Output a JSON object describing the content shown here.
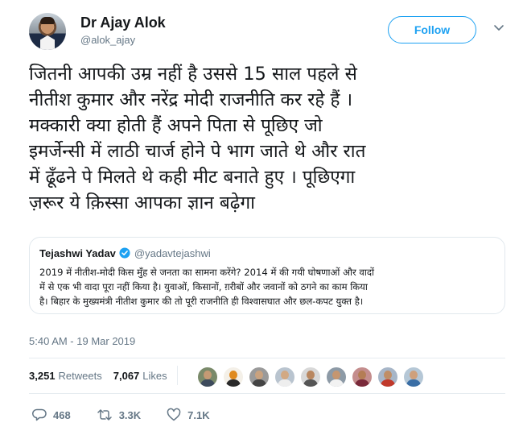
{
  "author": {
    "name": "Dr Ajay Alok",
    "handle": "@alok_ajay",
    "follow_label": "Follow"
  },
  "tweet": {
    "text": "जितनी आपकी उम्र नहीं है उससे 15 साल पहले से\nनीतीश कुमार और नरेंद्र मोदी राजनीति कर रहे हैं ।\nमक्कारी क्या होती हैं अपने पिता से पूछिए जो\nइमर्जेन्सी में लाठी चार्ज होने पे भाग जाते थे और रात\nमें ढूँढने पे मिलते थे कही मीट बनाते हुए । पूछिएगा\nज़रूर ये क़िस्सा आपका ज्ञान बढ़ेगा",
    "timestamp": "5:40 AM - 19 Mar 2019"
  },
  "quoted": {
    "name": "Tejashwi Yadav",
    "handle": "@yadavtejashwi",
    "text": "2019 में नीतीश-मोदी किस मुँह से जनता का सामना करेंगे? 2014 में की गयी घोषणाओं और वादों\nमें से एक भी वादा पूरा नहीं किया है। युवाओं, किसानों, ग़रीबों और जवानों को ठगने का काम किया\nहै। बिहार के मुख्यमंत्री नीतीश कुमार की तो पूरी राजनीति ही विश्वासघात और छल-कपट युक्त है।"
  },
  "stats": {
    "retweets_count": "3,251",
    "retweets_label": "Retweets",
    "likes_count": "7,067",
    "likes_label": "Likes"
  },
  "actions": {
    "replies": "468",
    "retweets": "3.3K",
    "likes": "7.1K"
  },
  "icons": {
    "verified": "verified-badge-icon",
    "caret": "chevron-down-icon",
    "reply": "reply-icon",
    "retweet": "retweet-icon",
    "like": "heart-icon"
  },
  "colors": {
    "accent": "#1da1f2",
    "text": "#14171a",
    "muted": "#657786",
    "border": "#e1e8ed"
  }
}
